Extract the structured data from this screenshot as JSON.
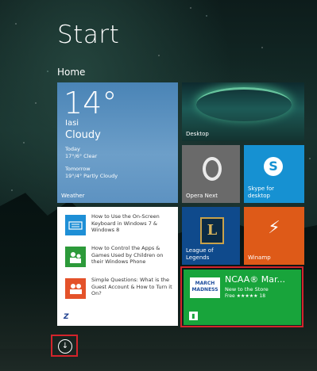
{
  "header": {
    "title": "Start",
    "group": "Home"
  },
  "tiles": {
    "weather": {
      "temp": "14°",
      "city": "Iasi",
      "condition": "Cloudy",
      "today_label": "Today",
      "today_forecast": "17°/6° Clear",
      "tomorrow_label": "Tomorrow",
      "tomorrow_forecast": "19°/4° Partly Cloudy",
      "label": "Weather"
    },
    "desktop": {
      "label": "Desktop"
    },
    "opera": {
      "label": "Opera Next",
      "icon": "opera-icon"
    },
    "skype": {
      "label": "Skype for desktop",
      "icon": "skype-icon"
    },
    "news": {
      "items": [
        {
          "text": "How to Use the On-Screen Keyboard in Windows 7 & Windows 8",
          "color": "#1e8fd6",
          "icon": "keyboard-icon"
        },
        {
          "text": "How to Control the Apps & Games Used by Children on their Windows Phone",
          "color": "#2c9a3a",
          "icon": "family-icon"
        },
        {
          "text": "Simple Questions: What is the Guest Account & How to Turn it On?",
          "color": "#e4522a",
          "icon": "users-icon"
        }
      ],
      "brand": "Z"
    },
    "lol": {
      "label": "League of Legends",
      "logo_letter": "L",
      "icon": "league-of-legends-icon"
    },
    "winamp": {
      "label": "Winamp",
      "icon": "winamp-icon"
    },
    "ncaa": {
      "title": "NCAA® Mar...",
      "subtitle": "New to the Store",
      "rating": "Free ★★★★★ 18",
      "logo_text": "MARCH MADNESS",
      "icon": "store-icon"
    }
  },
  "colors": {
    "highlight": "#d3242b",
    "store_green": "#18a43b"
  },
  "bottom": {
    "icon": "arrow-down-circle-icon"
  }
}
